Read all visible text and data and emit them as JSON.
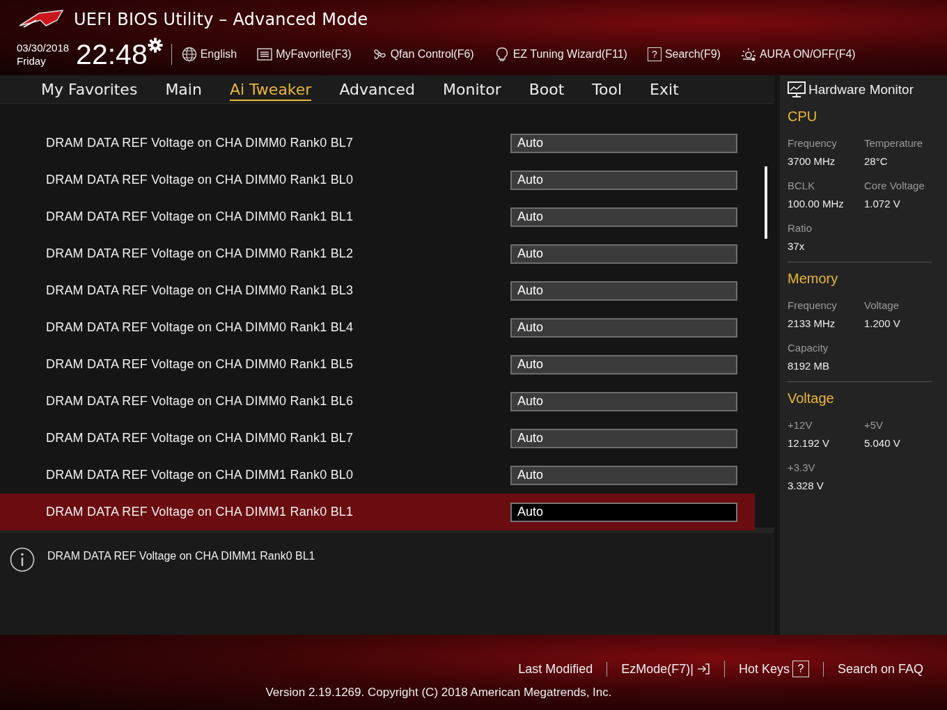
{
  "header": {
    "title": "UEFI BIOS Utility – Advanced Mode",
    "date": "03/30/2018",
    "day": "Friday",
    "time": "22:48",
    "toolbar": [
      {
        "label": "English"
      },
      {
        "label": "MyFavorite(F3)"
      },
      {
        "label": "Qfan Control(F6)"
      },
      {
        "label": "EZ Tuning Wizard(F11)"
      },
      {
        "label": "Search(F9)",
        "icon_text": "?"
      },
      {
        "label": "AURA ON/OFF(F4)"
      }
    ]
  },
  "tabs": [
    {
      "label": "My Favorites",
      "selected": false
    },
    {
      "label": "Main",
      "selected": false
    },
    {
      "label": "Ai Tweaker",
      "selected": true
    },
    {
      "label": "Advanced",
      "selected": false
    },
    {
      "label": "Monitor",
      "selected": false
    },
    {
      "label": "Boot",
      "selected": false
    },
    {
      "label": "Tool",
      "selected": false
    },
    {
      "label": "Exit",
      "selected": false
    }
  ],
  "settings": [
    {
      "label": "DRAM DATA REF Voltage on CHA DIMM0 Rank0 BL7",
      "value": "Auto",
      "selected": false
    },
    {
      "label": "DRAM DATA REF Voltage on CHA DIMM0 Rank1 BL0",
      "value": "Auto",
      "selected": false
    },
    {
      "label": "DRAM DATA REF Voltage on CHA DIMM0 Rank1 BL1",
      "value": "Auto",
      "selected": false
    },
    {
      "label": "DRAM DATA REF Voltage on CHA DIMM0 Rank1 BL2",
      "value": "Auto",
      "selected": false
    },
    {
      "label": "DRAM DATA REF Voltage on CHA DIMM0 Rank1 BL3",
      "value": "Auto",
      "selected": false
    },
    {
      "label": "DRAM DATA REF Voltage on CHA DIMM0 Rank1 BL4",
      "value": "Auto",
      "selected": false
    },
    {
      "label": "DRAM DATA REF Voltage on CHA DIMM0 Rank1 BL5",
      "value": "Auto",
      "selected": false
    },
    {
      "label": "DRAM DATA REF Voltage on CHA DIMM0 Rank1 BL6",
      "value": "Auto",
      "selected": false
    },
    {
      "label": "DRAM DATA REF Voltage on CHA DIMM0 Rank1 BL7",
      "value": "Auto",
      "selected": false
    },
    {
      "label": "DRAM DATA REF Voltage on CHA DIMM1 Rank0 BL0",
      "value": "Auto",
      "selected": false
    },
    {
      "label": "DRAM DATA REF Voltage on CHA DIMM1 Rank0 BL1",
      "value": "Auto",
      "selected": true
    }
  ],
  "info": {
    "text": "DRAM DATA REF Voltage on CHA DIMM1 Rank0 BL1"
  },
  "hardware_monitor": {
    "title": "Hardware Monitor",
    "sections": [
      {
        "title": "CPU",
        "items": [
          {
            "label": "Frequency",
            "value": "3700 MHz"
          },
          {
            "label": "Temperature",
            "value": "28°C"
          },
          {
            "label": "BCLK",
            "value": "100.00 MHz"
          },
          {
            "label": "Core Voltage",
            "value": "1.072 V"
          },
          {
            "label": "Ratio",
            "value": "37x"
          }
        ]
      },
      {
        "title": "Memory",
        "items": [
          {
            "label": "Frequency",
            "value": "2133 MHz"
          },
          {
            "label": "Voltage",
            "value": "1.200 V"
          },
          {
            "label": "Capacity",
            "value": "8192 MB"
          }
        ]
      },
      {
        "title": "Voltage",
        "items": [
          {
            "label": "+12V",
            "value": "12.192 V"
          },
          {
            "label": "+5V",
            "value": "5.040 V"
          },
          {
            "label": "+3.3V",
            "value": "3.328 V"
          }
        ]
      }
    ]
  },
  "footer": {
    "links": [
      {
        "label": "Last Modified"
      },
      {
        "label": "EzMode(F7)|"
      },
      {
        "label": "Hot Keys",
        "icon_text": "?"
      },
      {
        "label": "Search on FAQ"
      }
    ],
    "version": "Version 2.19.1269. Copyright (C) 2018 American Megatrends, Inc."
  }
}
